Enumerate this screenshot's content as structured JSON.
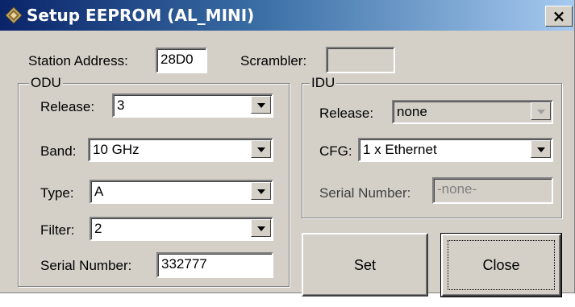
{
  "window": {
    "title": "Setup EEPROM (AL_MINI)",
    "close_glyph": "×"
  },
  "top": {
    "station_address_label": "Station Address:",
    "station_address_value": "28D0",
    "scrambler_label": "Scrambler:",
    "scrambler_value": ""
  },
  "odu": {
    "legend": "ODU",
    "release_label": "Release:",
    "release_value": "3",
    "band_label": "Band:",
    "band_value": "10 GHz",
    "type_label": "Type:",
    "type_value": "A",
    "filter_label": "Filter:",
    "filter_value": "2",
    "serial_label": "Serial Number:",
    "serial_value": "332777"
  },
  "idu": {
    "legend": "IDU",
    "release_label": "Release:",
    "release_value": "none",
    "cfg_label": "CFG:",
    "cfg_value": "1 x Ethernet",
    "serial_label": "Serial Number:",
    "serial_value": "-none-"
  },
  "buttons": {
    "set_label": "Set",
    "close_label": "Close"
  }
}
